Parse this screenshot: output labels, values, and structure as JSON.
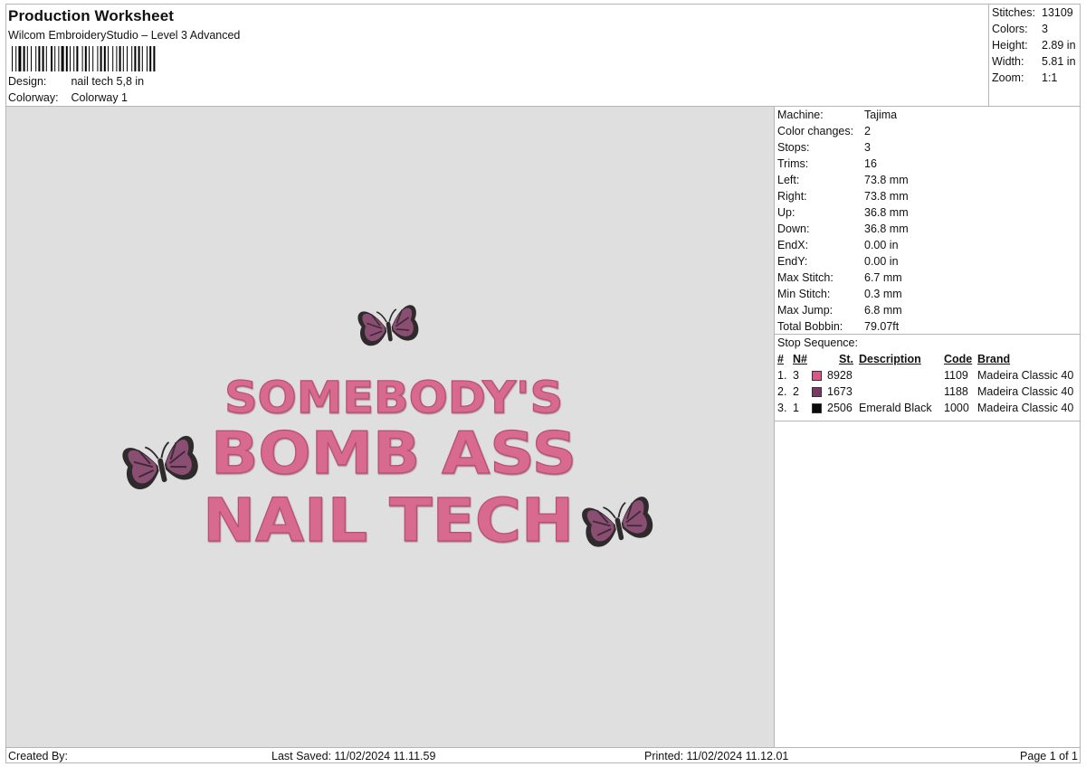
{
  "header": {
    "title": "Production Worksheet",
    "subtitle": "Wilcom EmbroideryStudio – Level 3 Advanced",
    "design_label": "Design:",
    "design_value": "nail tech 5,8 in",
    "colorway_label": "Colorway:",
    "colorway_value": "Colorway 1"
  },
  "summary": [
    {
      "label": "Stitches:",
      "value": "13109"
    },
    {
      "label": "Colors:",
      "value": "3"
    },
    {
      "label": "Height:",
      "value": "2.89 in"
    },
    {
      "label": "Width:",
      "value": "5.81 in"
    },
    {
      "label": "Zoom:",
      "value": "1:1"
    }
  ],
  "design": {
    "lines": [
      "SOMEBODY'S",
      "BOMB ASS",
      "NAIL TECH"
    ],
    "text_color": "#d96b8f",
    "butterfly_wing_color": "#8a4e72",
    "butterfly_outline_color": "#2f2a2c",
    "canvas_color": "#dfdfdf"
  },
  "machine": [
    {
      "label": "Machine:",
      "value": "Tajima"
    },
    {
      "label": "Color changes:",
      "value": "2"
    },
    {
      "label": "Stops:",
      "value": "3"
    },
    {
      "label": "Trims:",
      "value": "16"
    },
    {
      "label": "Left:",
      "value": "73.8 mm"
    },
    {
      "label": "Right:",
      "value": "73.8 mm"
    },
    {
      "label": "Up:",
      "value": "36.8 mm"
    },
    {
      "label": "Down:",
      "value": "36.8 mm"
    },
    {
      "label": "EndX:",
      "value": "0.00 in"
    },
    {
      "label": "EndY:",
      "value": "0.00 in"
    },
    {
      "label": "Max Stitch:",
      "value": "6.7 mm"
    },
    {
      "label": "Min Stitch:",
      "value": "0.3 mm"
    },
    {
      "label": "Max Jump:",
      "value": "6.8 mm"
    },
    {
      "label": "Total Bobbin:",
      "value": "79.07ft"
    }
  ],
  "stops": {
    "title": "Stop Sequence:",
    "headers": {
      "idx": "#",
      "n": "N#",
      "st": "St.",
      "desc": "Description",
      "code": "Code",
      "brand": "Brand"
    },
    "rows": [
      {
        "idx": "1.",
        "n": "3",
        "color": "#d9578a",
        "st": "8928",
        "desc": "",
        "code": "1109",
        "brand": "Madeira Classic 40"
      },
      {
        "idx": "2.",
        "n": "2",
        "color": "#7a3866",
        "st": "1673",
        "desc": "",
        "code": "1188",
        "brand": "Madeira Classic 40"
      },
      {
        "idx": "3.",
        "n": "1",
        "color": "#0a0a0a",
        "st": "2506",
        "desc": "Emerald Black",
        "code": "1000",
        "brand": "Madeira Classic 40"
      }
    ]
  },
  "footer": {
    "created": "Created By:",
    "saved": "Last Saved: 11/02/2024 11.11.59",
    "printed": "Printed: 11/02/2024 11.12.01",
    "page": "Page 1 of 1"
  }
}
